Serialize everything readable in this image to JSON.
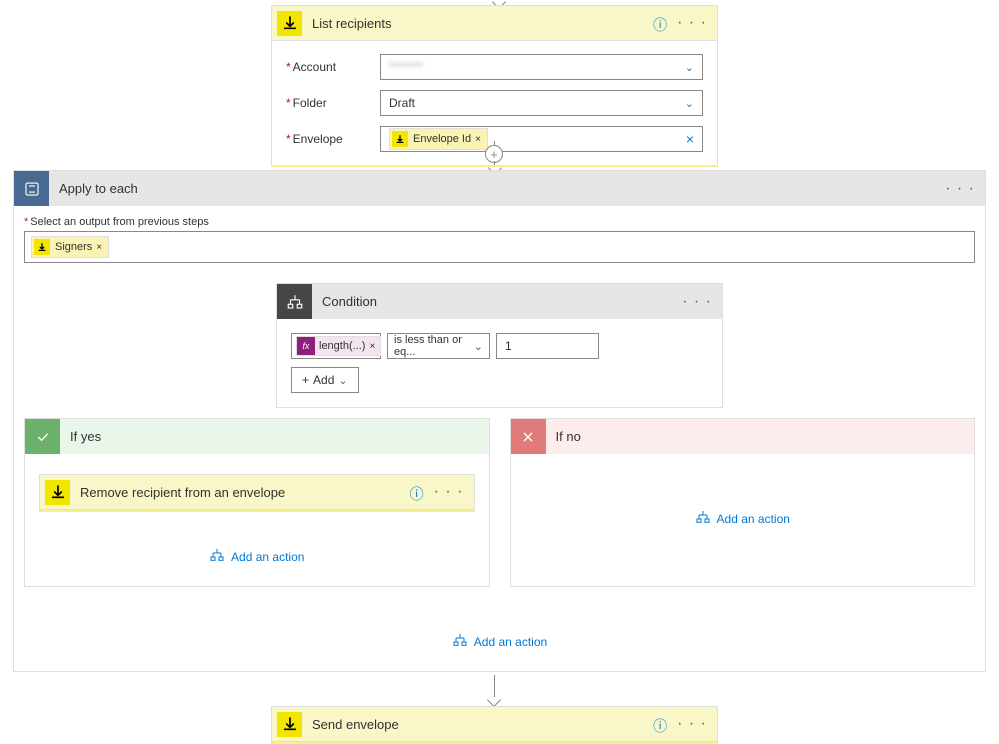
{
  "list_recipients": {
    "title": "List recipients",
    "fields": {
      "account": {
        "label": "Account",
        "value": "********"
      },
      "folder": {
        "label": "Folder",
        "value": "Draft"
      },
      "envelope": {
        "label": "Envelope",
        "token": "Envelope Id"
      }
    }
  },
  "apply_to_each": {
    "title": "Apply to each",
    "select_label": "Select an output from previous steps",
    "signers_token": "Signers"
  },
  "condition": {
    "title": "Condition",
    "expression_token": "length(...)",
    "operator": "is less than or eq...",
    "value": "1",
    "add_button": "Add"
  },
  "branches": {
    "yes": {
      "title": "If yes",
      "action_title": "Remove recipient from an envelope",
      "add_action": "Add an action"
    },
    "no": {
      "title": "If no",
      "add_action": "Add an action"
    },
    "bottom_add_action": "Add an action"
  },
  "send_envelope": {
    "title": "Send envelope"
  }
}
